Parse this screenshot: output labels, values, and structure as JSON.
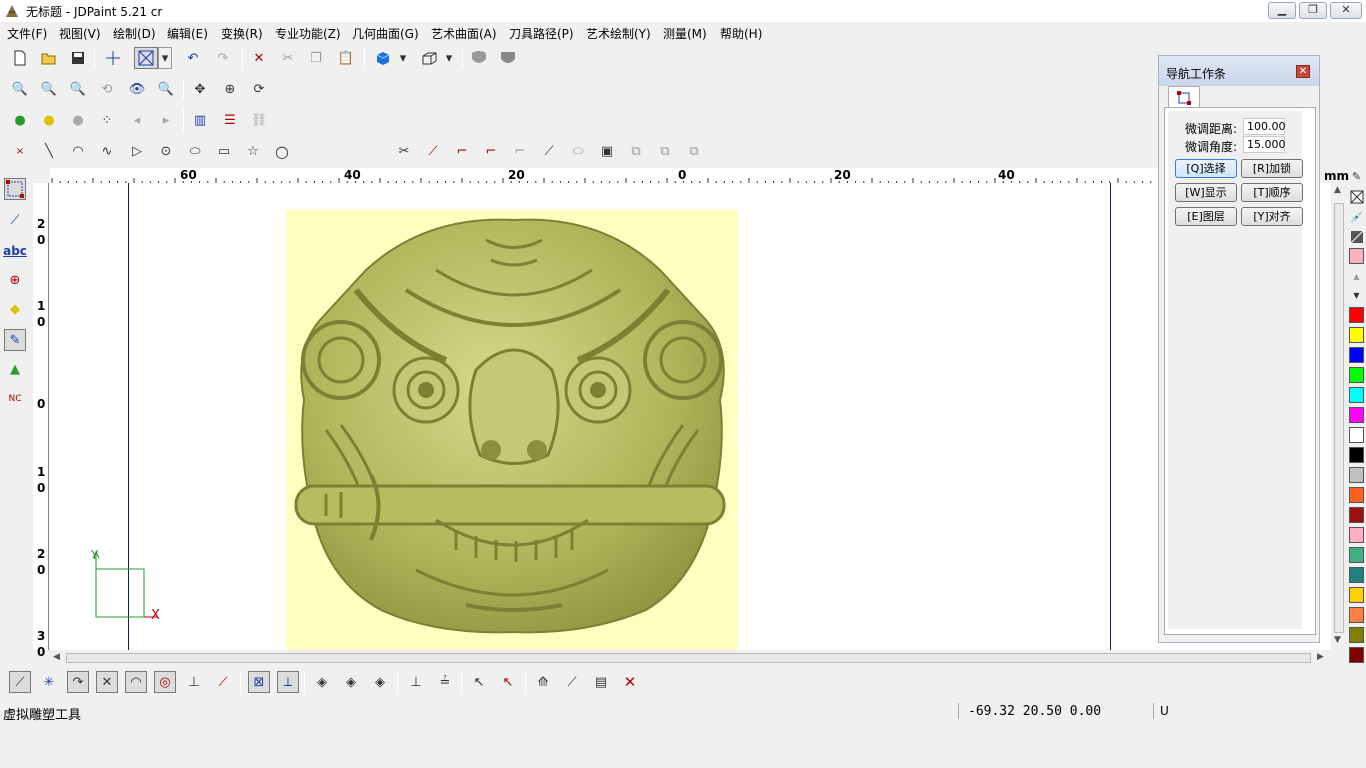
{
  "window": {
    "title": "无标题 - JDPaint 5.21 cr",
    "min": "▁",
    "max": "❐",
    "close": "✕"
  },
  "menu": [
    "文件(F)",
    "视图(V)",
    "绘制(D)",
    "编辑(E)",
    "变换(R)",
    "专业功能(Z)",
    "几何曲面(G)",
    "艺术曲面(A)",
    "刀具路径(P)",
    "艺术绘制(Y)",
    "测量(M)",
    "帮助(H)"
  ],
  "ruler": {
    "h_labels": [
      "60",
      "40",
      "20",
      "0",
      "20",
      "40"
    ],
    "unit": "mm",
    "v_labels": [
      [
        "2",
        "0"
      ],
      [
        "1",
        "0"
      ],
      [
        "0"
      ],
      [
        "1",
        "0"
      ],
      [
        "2",
        "0"
      ],
      [
        "3",
        "0"
      ]
    ]
  },
  "axes": {
    "x": "X",
    "y": "Y"
  },
  "nav_panel": {
    "title": "导航工作条",
    "fine_distance_label": "微调距离:",
    "fine_distance_value": "100.00",
    "fine_angle_label": "微调角度:",
    "fine_angle_value": "15.000",
    "buttons": [
      "[Q]选择",
      "[R]加锁",
      "[W]显示",
      "[T]顺序",
      "[E]图层",
      "[Y]对齐"
    ]
  },
  "palette": [
    "#ff0000",
    "#ffff00",
    "#0000ff",
    "#00ff00",
    "#00ffff",
    "#ff00ff",
    "#ffffff",
    "#000000",
    "#c0c0c0",
    "#ff6020",
    "#a01010",
    "#ffb0c0",
    "#40b080",
    "#208080",
    "#ffd000",
    "#ff8040",
    "#808000",
    "#800000"
  ],
  "status": {
    "tool": "虚拟雕塑工具",
    "coords": "-69.32 20.50 0.00",
    "mode": "U"
  },
  "colors": {
    "relief_bg": "#ffffbf",
    "relief": "#b8bb5e"
  }
}
